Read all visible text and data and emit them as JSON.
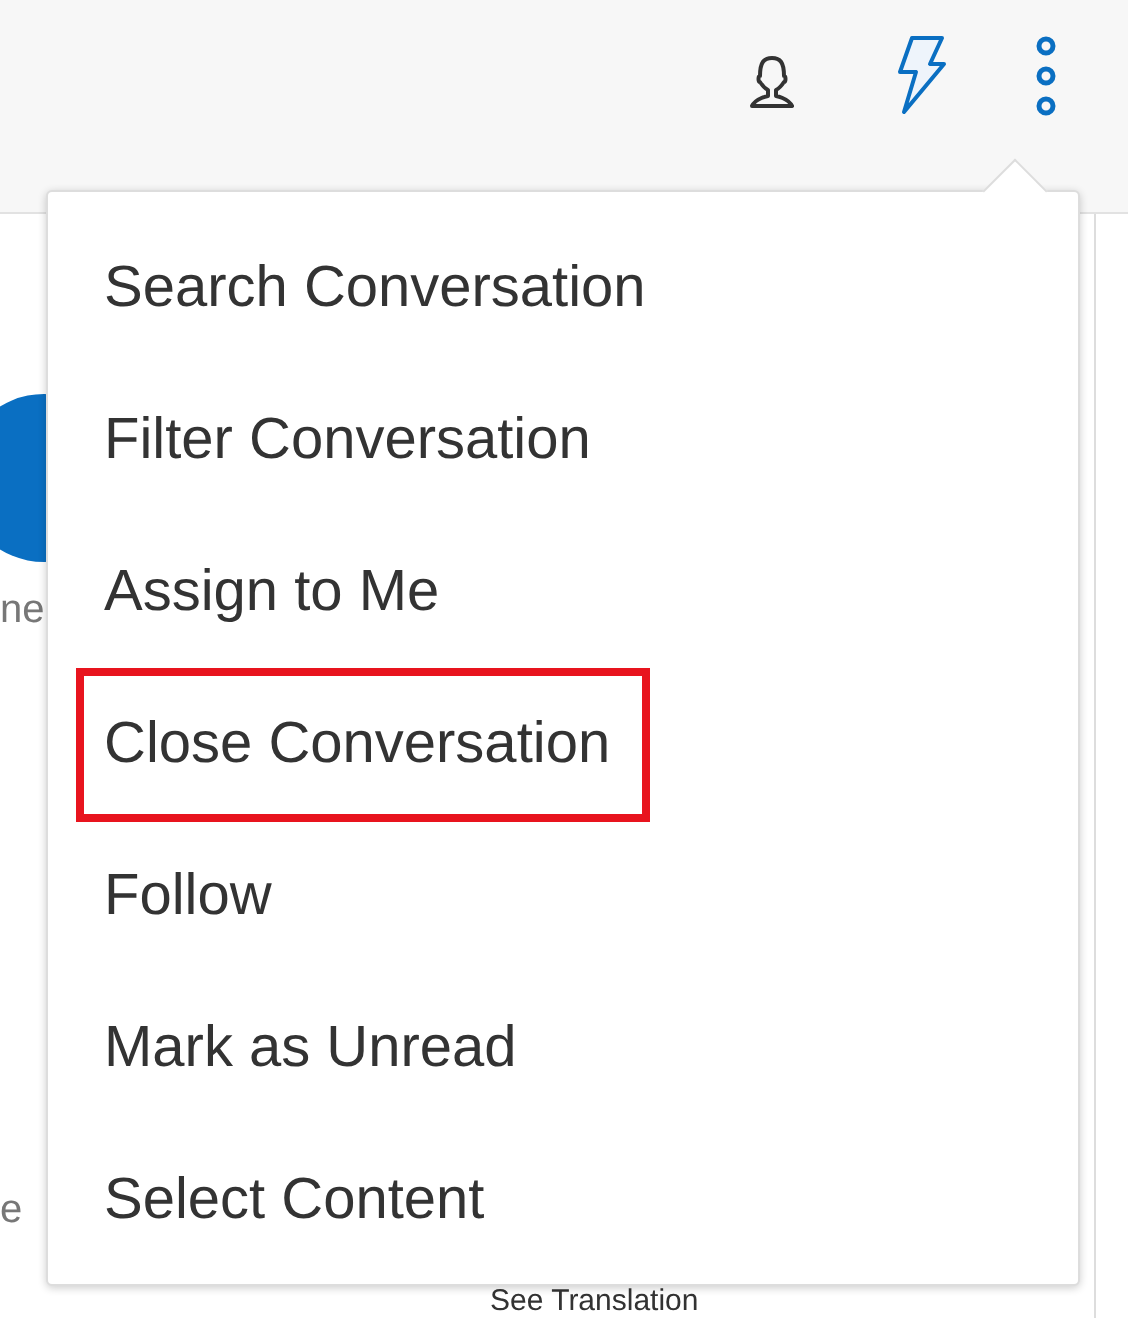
{
  "menu": {
    "items": [
      {
        "label": "Search Conversation",
        "highlighted": false
      },
      {
        "label": "Filter Conversation",
        "highlighted": false
      },
      {
        "label": "Assign to Me",
        "highlighted": false
      },
      {
        "label": "Close Conversation",
        "highlighted": true
      },
      {
        "label": "Follow",
        "highlighted": false
      },
      {
        "label": "Mark as Unread",
        "highlighted": false
      },
      {
        "label": "Select Content",
        "highlighted": false
      }
    ]
  },
  "background": {
    "texts": [
      "ne",
      "e"
    ],
    "link": "See Translation"
  }
}
